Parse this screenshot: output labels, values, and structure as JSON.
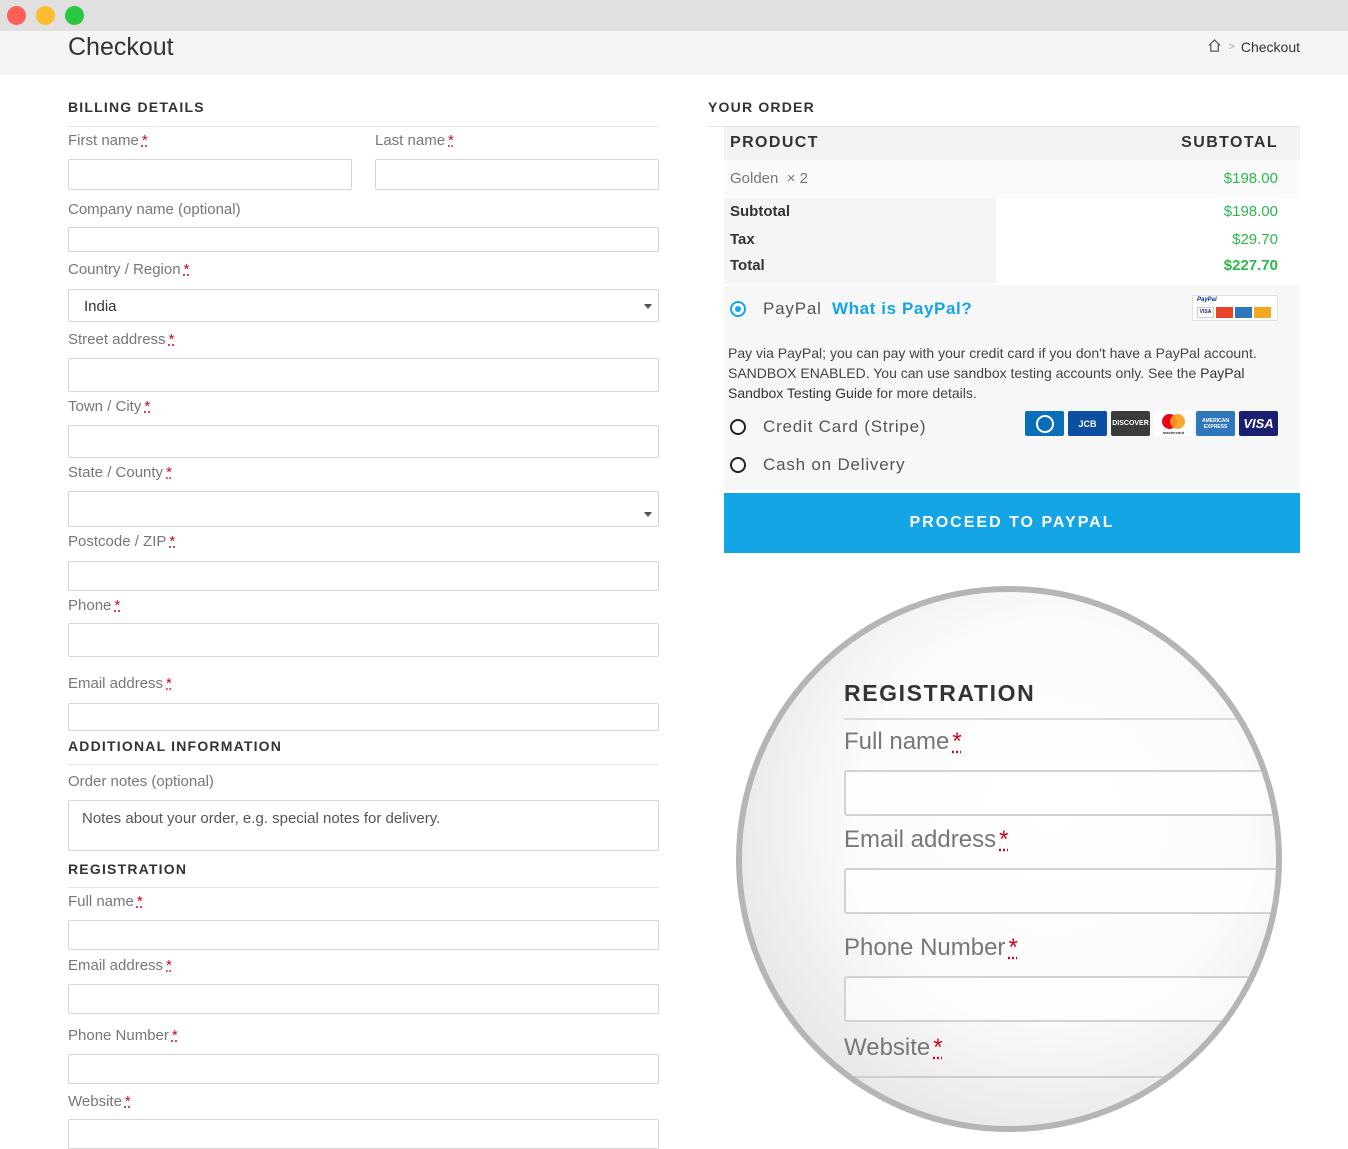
{
  "window": {
    "controls": [
      "close",
      "minimize",
      "maximize"
    ]
  },
  "header": {
    "title": "Checkout",
    "breadcrumb": {
      "home_icon": "home-icon",
      "separator": ">",
      "current": "Checkout"
    }
  },
  "billing": {
    "heading": "BILLING DETAILS",
    "required_mark": "*",
    "first_name": "First name",
    "last_name": "Last name",
    "company": "Company name (optional)",
    "country": "Country / Region",
    "country_value": "India",
    "street": "Street address",
    "city": "Town / City",
    "state": "State / County",
    "postcode": "Postcode / ZIP",
    "phone": "Phone",
    "email": "Email address"
  },
  "additional": {
    "heading": "ADDITIONAL INFORMATION",
    "notes_label": "Order notes (optional)",
    "notes_placeholder": "Notes about your order, e.g. special notes for delivery."
  },
  "registration": {
    "heading": "REGISTRATION",
    "full_name": "Full name",
    "email": "Email address",
    "phone": "Phone Number",
    "website": "Website"
  },
  "order": {
    "heading": "YOUR ORDER",
    "col_product": "PRODUCT",
    "col_subtotal": "SUBTOTAL",
    "item_name": "Golden",
    "item_qty": "× 2",
    "item_total": "$198.00",
    "subtotal_label": "Subtotal",
    "subtotal_value": "$198.00",
    "tax_label": "Tax",
    "tax_value": "$29.70",
    "total_label": "Total",
    "total_value": "$227.70",
    "value_color": "#2db84d"
  },
  "payment": {
    "paypal_label": "PayPal",
    "paypal_link": "What is PayPal?",
    "paypal_desc_1": "Pay via PayPal; you can pay with your credit card if you don't have a PayPal account.",
    "paypal_desc_2": "SANDBOX ENABLED. You can use sandbox testing accounts only. See the ",
    "paypal_desc_link": "PayPal Sandbox Testing Guide",
    "paypal_desc_3": " for more details.",
    "stripe_label": "Credit Card (Stripe)",
    "cod_label": "Cash on Delivery",
    "selected": "PayPal",
    "cards": [
      "DISCOVER",
      "mastercard",
      "AMERICAN EXPRESS",
      "VISA"
    ],
    "paypal_logo_text": "PayPal",
    "accent": "#13a5e6"
  },
  "proceed_button": "PROCEED TO PAYPAL",
  "magnifier": {
    "heading": "REGISTRATION",
    "full_name": "Full name",
    "email": "Email address",
    "phone": "Phone Number",
    "website": "Website"
  }
}
